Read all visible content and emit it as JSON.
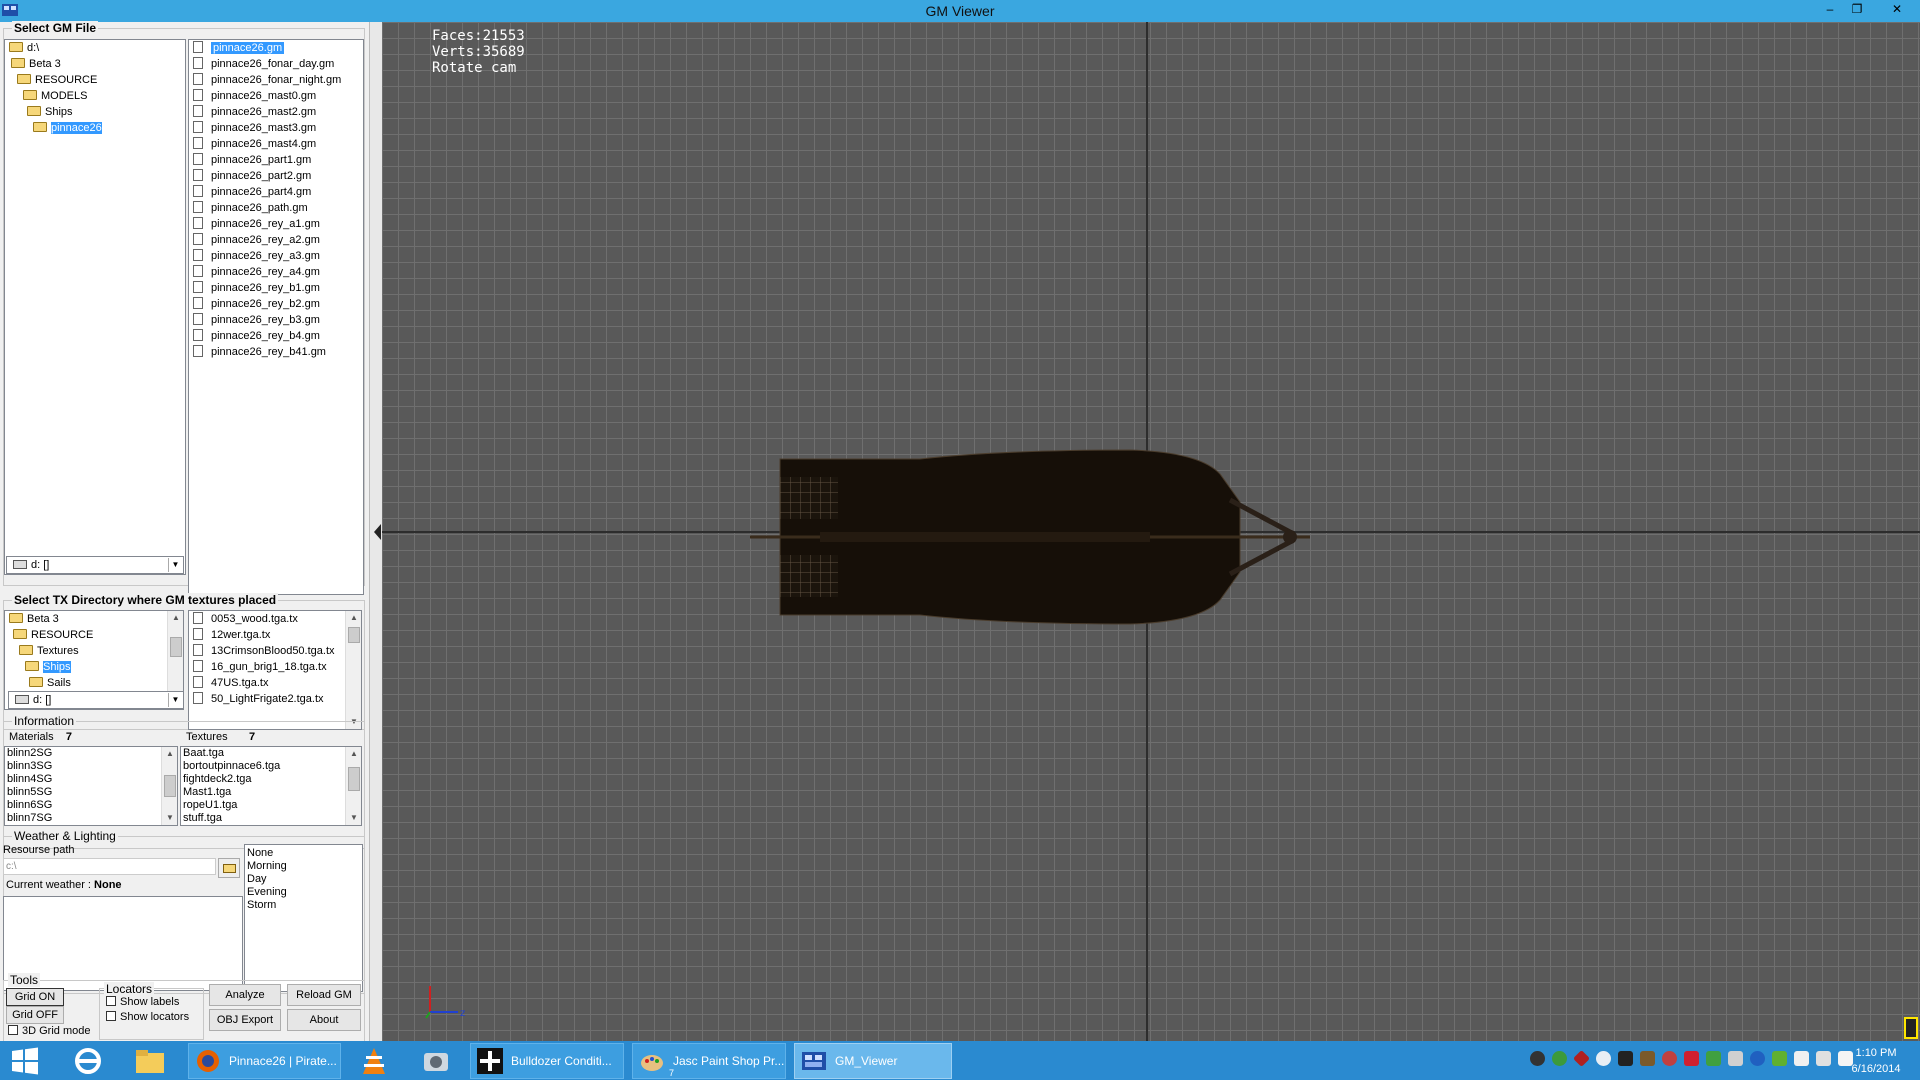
{
  "window": {
    "title": "GM Viewer",
    "min_glyph": "–",
    "max_glyph": "❐",
    "close_glyph": "✕"
  },
  "gm_file": {
    "title": "Select GM File",
    "tree": [
      {
        "label": "d:\\",
        "selected": false
      },
      {
        "label": "Beta 3",
        "selected": false
      },
      {
        "label": "RESOURCE",
        "selected": false
      },
      {
        "label": "MODELS",
        "selected": false
      },
      {
        "label": "Ships",
        "selected": false
      },
      {
        "label": "pinnace26",
        "selected": true
      }
    ],
    "drive": "d: []",
    "files": [
      "pinnace26.gm",
      "pinnace26_fonar_day.gm",
      "pinnace26_fonar_night.gm",
      "pinnace26_mast0.gm",
      "pinnace26_mast2.gm",
      "pinnace26_mast3.gm",
      "pinnace26_mast4.gm",
      "pinnace26_part1.gm",
      "pinnace26_part2.gm",
      "pinnace26_part4.gm",
      "pinnace26_path.gm",
      "pinnace26_rey_a1.gm",
      "pinnace26_rey_a2.gm",
      "pinnace26_rey_a3.gm",
      "pinnace26_rey_a4.gm",
      "pinnace26_rey_b1.gm",
      "pinnace26_rey_b2.gm",
      "pinnace26_rey_b3.gm",
      "pinnace26_rey_b4.gm",
      "pinnace26_rey_b41.gm"
    ]
  },
  "tx_dir": {
    "title": "Select TX Directory where GM textures placed",
    "tree": [
      {
        "label": "Beta 3",
        "selected": false
      },
      {
        "label": "RESOURCE",
        "selected": false
      },
      {
        "label": "Textures",
        "selected": false
      },
      {
        "label": "Ships",
        "selected": true
      },
      {
        "label": "Sails",
        "selected": false
      }
    ],
    "drive": "d: []",
    "files": [
      "0053_wood.tga.tx",
      "12wer.tga.tx",
      "13CrimsonBlood50.tga.tx",
      "16_gun_brig1_18.tga.tx",
      "47US.tga.tx",
      "50_LightFrigate2.tga.tx"
    ]
  },
  "info": {
    "title": "Information",
    "materials_label": "Materials",
    "materials_count": "7",
    "textures_label": "Textures",
    "textures_count": "7",
    "materials": [
      "blinn2SG",
      "blinn3SG",
      "blinn4SG",
      "blinn5SG",
      "blinn6SG",
      "blinn7SG"
    ],
    "textures": [
      "Baat.tga",
      "bortoutpinnace6.tga",
      "fightdeck2.tga",
      "Mast1.tga",
      "ropeU1.tga",
      "stuff.tga"
    ]
  },
  "weather": {
    "title": "Weather & Lighting",
    "resource_path_label": "Resourse path",
    "resource_path_value": "c:\\",
    "current_label": "Current weather :",
    "current_value": "None",
    "options": [
      "None",
      "Morning",
      "Day",
      "Evening",
      "Storm"
    ]
  },
  "tools": {
    "title": "Tools",
    "grid_on": "Grid ON",
    "grid_off": "Grid OFF",
    "grid_3d": "3D Grid mode",
    "locators_title": "Locators",
    "show_labels": "Show labels",
    "show_locators": "Show locators",
    "analyze": "Analyze",
    "reload": "Reload GM",
    "obj_export": "OBJ Export",
    "about": "About"
  },
  "viewport": {
    "faces": "Faces:21553",
    "verts": "Verts:35689",
    "mode": "Rotate cam",
    "background_color": "#595959",
    "grid_color": "#6f6f6f"
  },
  "taskbar": {
    "apps": [
      {
        "label": "Pinnace26 | Pirate...",
        "icon": "firefox-icon",
        "active": false
      },
      {
        "label": "Bulldozer Conditi...",
        "icon": "bulldozer-icon",
        "active": false
      },
      {
        "label": "Jasc Paint Shop Pr...",
        "icon": "paintshop-icon",
        "active": false,
        "badge": "7"
      },
      {
        "label": "GM_Viewer",
        "icon": "gm-viewer-icon",
        "active": true
      }
    ],
    "time": "1:10 PM",
    "date": "6/16/2014"
  },
  "colors": {
    "accent": "#3399ff",
    "titlebar": "#3aa7e0",
    "taskbar": "#2a8ad0"
  }
}
